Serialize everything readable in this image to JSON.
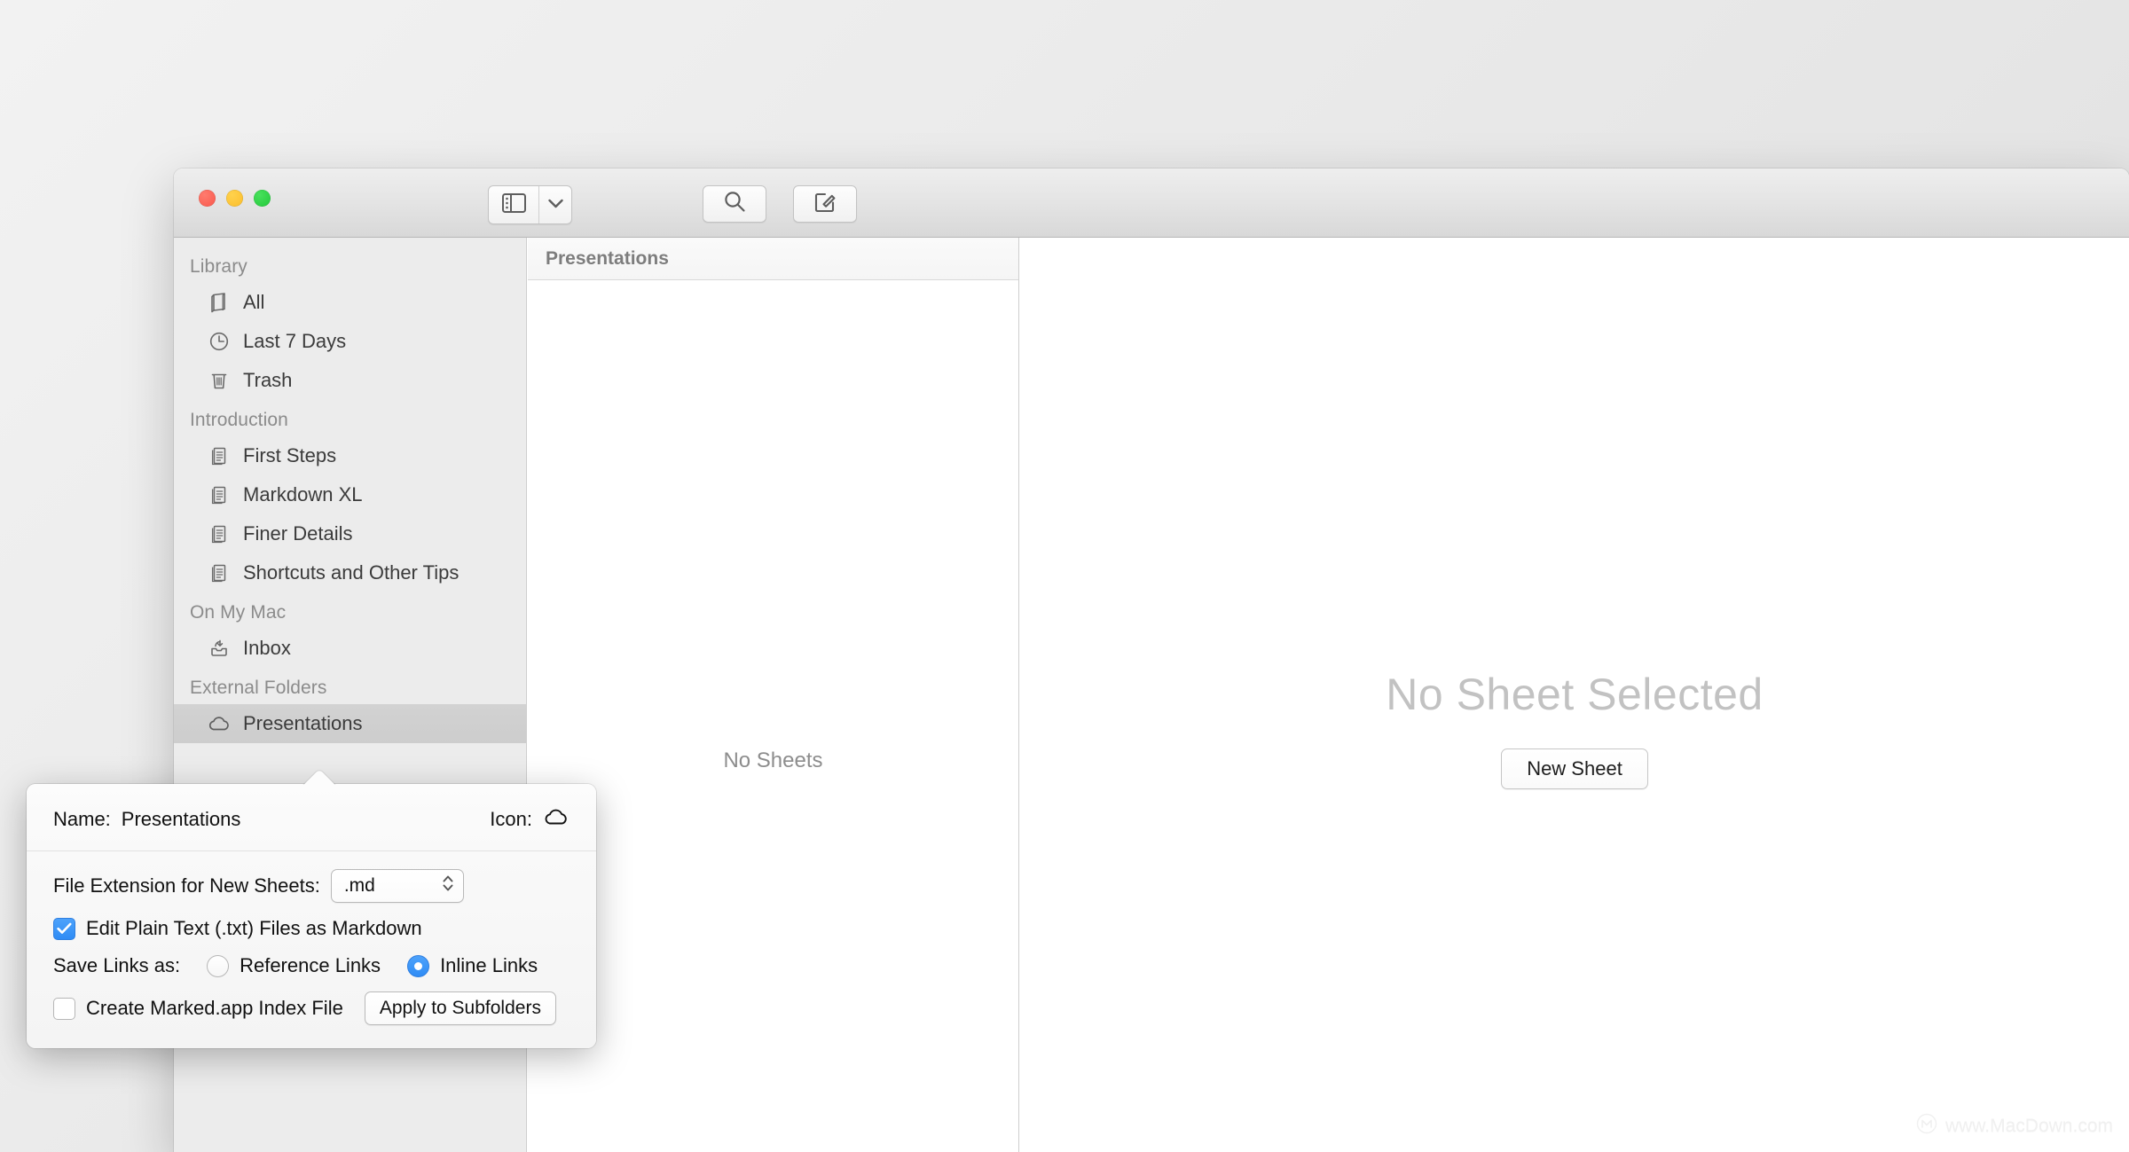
{
  "window": {
    "traffic_lights": [
      "close",
      "minimize",
      "maximize"
    ]
  },
  "toolbar": {
    "sidebar_toggle_icon": "sidebar-icon",
    "sidebar_toggle_chevron_icon": "chevron-down-icon",
    "search_icon": "search-icon",
    "compose_icon": "compose-icon"
  },
  "sidebar": {
    "sections": [
      {
        "title": "Library",
        "items": [
          {
            "label": "All",
            "icon": "book-icon",
            "selected": false
          },
          {
            "label": "Last 7 Days",
            "icon": "clock-icon",
            "selected": false
          },
          {
            "label": "Trash",
            "icon": "trash-icon",
            "selected": false
          }
        ]
      },
      {
        "title": "Introduction",
        "items": [
          {
            "label": "First Steps",
            "icon": "document-icon",
            "selected": false
          },
          {
            "label": "Markdown XL",
            "icon": "document-icon",
            "selected": false
          },
          {
            "label": "Finer Details",
            "icon": "document-icon",
            "selected": false
          },
          {
            "label": "Shortcuts and Other Tips",
            "icon": "document-icon",
            "selected": false
          }
        ]
      },
      {
        "title": "On My Mac",
        "items": [
          {
            "label": "Inbox",
            "icon": "inbox-icon",
            "selected": false
          }
        ]
      },
      {
        "title": "External Folders",
        "items": [
          {
            "label": "Presentations",
            "icon": "cloud-icon",
            "selected": true
          }
        ]
      }
    ]
  },
  "sheet_list": {
    "header": "Presentations",
    "empty_message": "No Sheets"
  },
  "editor": {
    "empty_title": "No Sheet Selected",
    "new_sheet_label": "New Sheet"
  },
  "popover": {
    "name_label": "Name:",
    "name_value": "Presentations",
    "icon_label": "Icon:",
    "icon_glyph": "cloud-icon",
    "file_extension_label": "File Extension for New Sheets:",
    "file_extension_value": ".md",
    "edit_plain_text_label": "Edit Plain Text (.txt) Files as Markdown",
    "edit_plain_text_checked": true,
    "save_links_label": "Save Links as:",
    "reference_links_label": "Reference Links",
    "reference_links_selected": false,
    "inline_links_label": "Inline Links",
    "inline_links_selected": true,
    "marked_index_label": "Create Marked.app Index File",
    "marked_index_checked": false,
    "apply_subfolders_label": "Apply to Subfolders"
  },
  "watermark": {
    "text": "www.MacDown.com",
    "logo_icon": "macdown-logo-icon"
  },
  "colors": {
    "accent": "#2f8cf5",
    "sidebar_bg": "#ececec",
    "selection": "#d0d0d0"
  }
}
